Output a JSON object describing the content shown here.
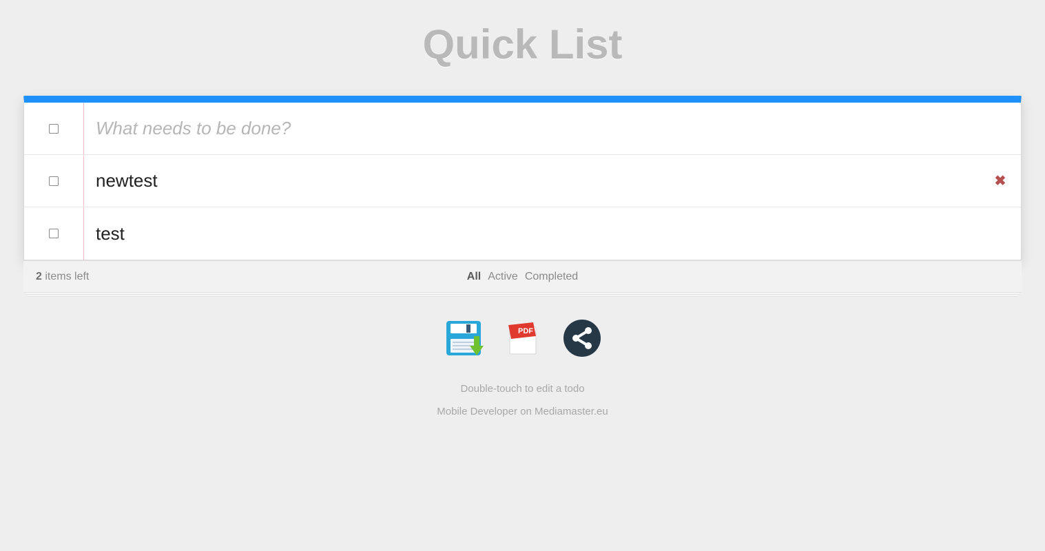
{
  "header": {
    "title": "Quick List"
  },
  "input": {
    "placeholder": "What needs to be done?"
  },
  "items": [
    {
      "label": "newtest",
      "completed": false,
      "show_destroy": true
    },
    {
      "label": "test",
      "completed": false,
      "show_destroy": false
    }
  ],
  "footer": {
    "count_number": "2",
    "count_suffix": " items left",
    "filters": {
      "all": "All",
      "active": "Active",
      "completed": "Completed",
      "selected": "all"
    }
  },
  "actions": {
    "save": "save-icon",
    "pdf": "pdf-icon",
    "share": "share-icon"
  },
  "hints": {
    "line1": "Double-touch to edit a todo",
    "line2_prefix": "Mobile Developer on ",
    "line2_link": "Mediamaster.eu"
  },
  "colors": {
    "accent": "#1e90ff",
    "destroy": "#b45050",
    "pdf_red": "#e03a2f",
    "save_blue": "#28a7d8",
    "save_green": "#6fc12f",
    "share_navy": "#263746"
  }
}
